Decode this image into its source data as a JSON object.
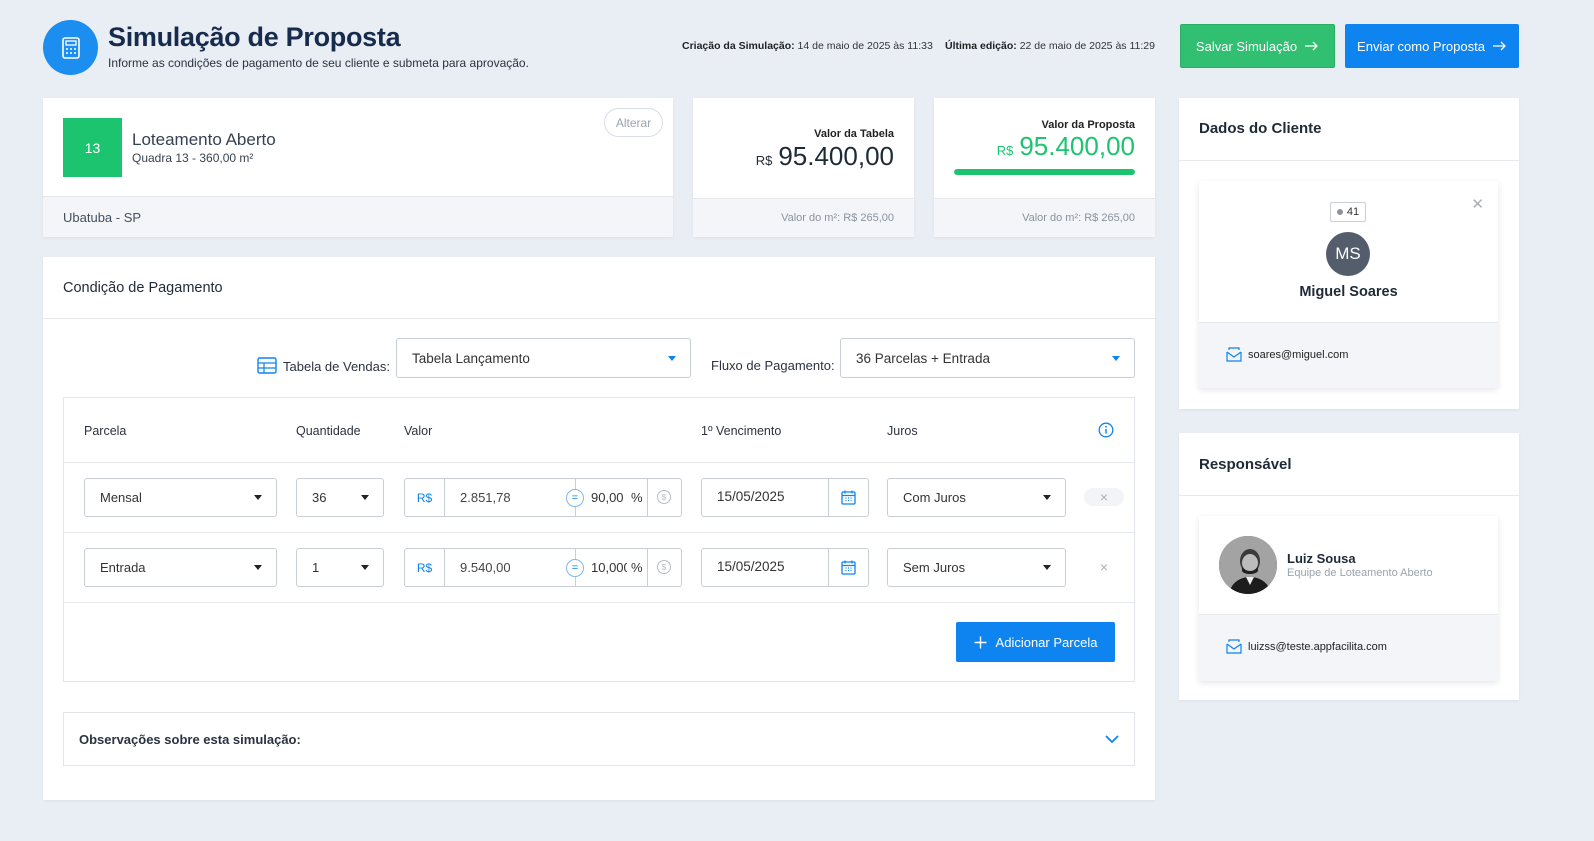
{
  "header": {
    "title": "Simulação de Proposta",
    "subtitle": "Informe as condições de pagamento de seu cliente e submeta para aprovação.",
    "created_label": "Criação da Simulação:",
    "created_value": "14 de maio de 2025 às 11:33",
    "edited_label": "Última edição:",
    "edited_value": "22 de maio de 2025 às 11:29",
    "save_button": "Salvar Simulação",
    "send_button": "Enviar como Proposta",
    "icon": "calculator-icon"
  },
  "lot": {
    "badge": "13",
    "name": "Loteamento Aberto",
    "detail": "Quadra 13 - 360,00 m²",
    "change_button": "Alterar",
    "location": "Ubatuba - SP"
  },
  "table_value": {
    "label": "Valor da Tabela",
    "currency": "R$",
    "amount": "95.400,00",
    "m2": "Valor do m²: R$ 265,00"
  },
  "proposal_value": {
    "label": "Valor da Proposta",
    "currency": "R$",
    "amount": "95.400,00",
    "progress": 1.0,
    "m2": "Valor do m²: R$ 265,00"
  },
  "payment": {
    "title": "Condição de Pagamento",
    "sales_table_label": "Tabela de Vendas:",
    "sales_table_value": "Tabela Lançamento",
    "flow_label": "Fluxo de Pagamento:",
    "flow_value": "36 Parcelas + Entrada",
    "columns": [
      "Parcela",
      "Quantidade",
      "Valor",
      "1º Vencimento",
      "Juros"
    ],
    "rows": [
      {
        "parcela": "Mensal",
        "quantidade": "36",
        "currency": "R$",
        "valor": "2.851,78",
        "percent": "90,00",
        "vencimento": "15/05/2025",
        "juros": "Com Juros"
      },
      {
        "parcela": "Entrada",
        "quantidade": "1",
        "currency": "R$",
        "valor": "9.540,00",
        "percent": "10,000",
        "vencimento": "15/05/2025",
        "juros": "Sem Juros"
      }
    ],
    "percent_symbol": "%",
    "equals_symbol": "=",
    "remove_symbol": "×",
    "add_button": "Adicionar Parcela",
    "notes_label": "Observações sobre esta simulação:"
  },
  "client": {
    "title": "Dados do Cliente",
    "tag": "41",
    "initials": "MS",
    "name": "Miguel Soares",
    "email": "soares@miguel.com"
  },
  "responsible": {
    "title": "Responsável",
    "name": "Luiz Sousa",
    "team": "Equipe de Loteamento Aberto",
    "email": "luizss@teste.appfacilita.com"
  },
  "colors": {
    "primary": "#0d84ef",
    "success": "#1cc46f",
    "background": "#e9eef5"
  }
}
